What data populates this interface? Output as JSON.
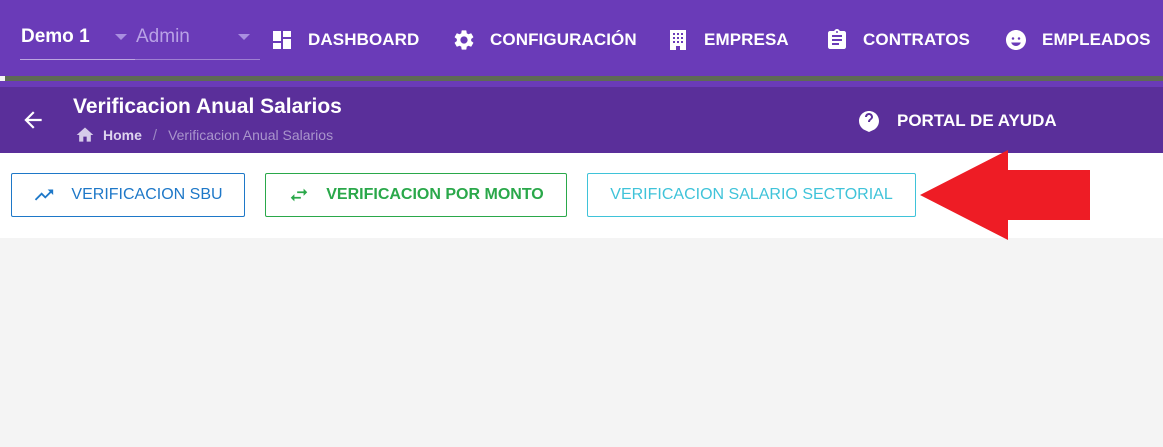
{
  "top_nav": {
    "company_select": {
      "value": "Demo 1"
    },
    "role_select": {
      "value": "Admin"
    },
    "items": [
      {
        "label": "DASHBOARD",
        "icon": "dashboard-icon"
      },
      {
        "label": "CONFIGURACIÓN",
        "icon": "gear-icon"
      },
      {
        "label": "EMPRESA",
        "icon": "building-icon"
      },
      {
        "label": "CONTRATOS",
        "icon": "clipboard-icon"
      },
      {
        "label": "EMPLEADOS",
        "icon": "smile-icon"
      }
    ]
  },
  "page_header": {
    "title": "Verificacion Anual Salarios",
    "breadcrumb": {
      "home": "Home",
      "separator": "/",
      "current": "Verificacion Anual Salarios"
    },
    "help_label": "PORTAL DE AYUDA"
  },
  "actions": [
    {
      "label": "VERIFICACION SBU",
      "icon": "trending-up-icon",
      "color": "#1e78c8"
    },
    {
      "label": "VERIFICACION POR MONTO",
      "icon": "swap-arrows-icon",
      "color": "#2aa84a"
    },
    {
      "label": "VERIFICACION SALARIO SECTORIAL",
      "color": "#3fc3d9"
    }
  ],
  "annotation": {
    "icon": "red-arrow-icon",
    "color": "#ee1c25"
  },
  "colors": {
    "nav_bg": "#6a3bb8",
    "subheader_bg": "#5a2f9a",
    "page_bg": "#f4f4f4"
  }
}
